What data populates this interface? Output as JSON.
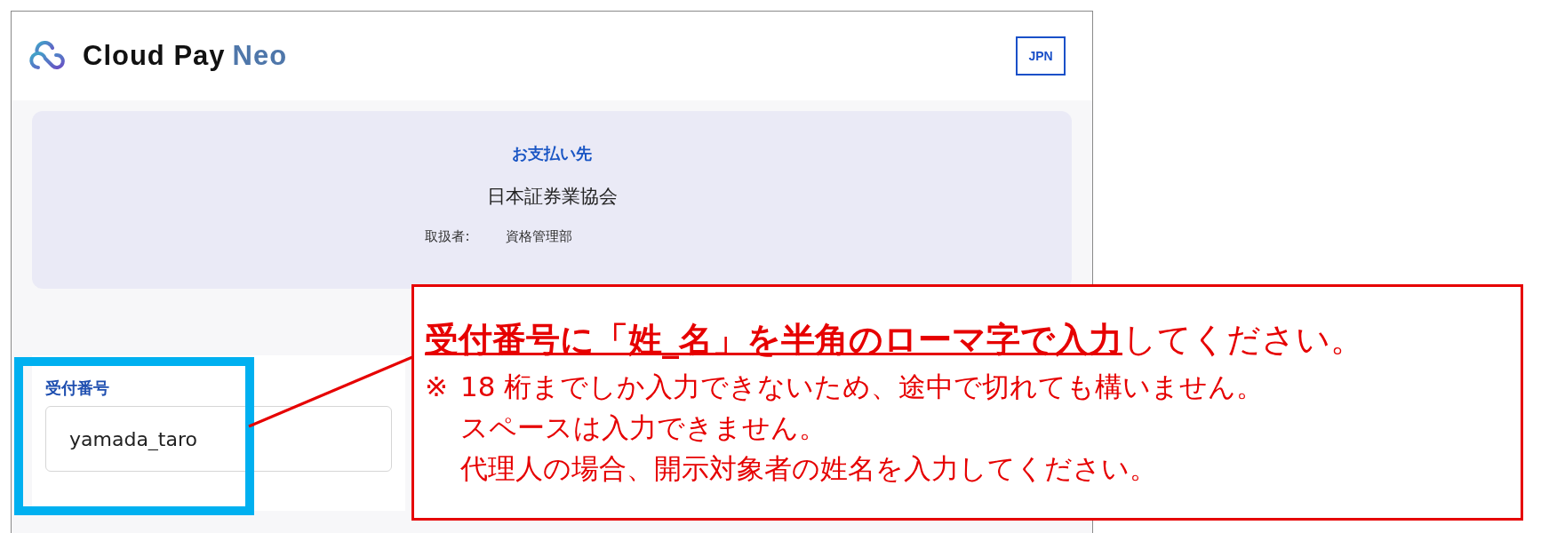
{
  "header": {
    "logo_text": "Cloud Pay",
    "logo_accent": "Neo",
    "language_button": "JPN"
  },
  "payee_card": {
    "heading": "お支払い先",
    "name": "日本証券業協会",
    "handler_label": "取扱者:",
    "handler_value": "資格管理部"
  },
  "field": {
    "label": "受付番号",
    "value": "yamada_taro"
  },
  "annotation": {
    "headline": "**受付番号に「姓_名」を半角のローマ字で入力**してください。",
    "mark": "※",
    "notes": [
      "18 桁までしか入力できないため、途中で切れても構いません。",
      "スペースは入力できません。",
      "代理人の場合、開示対象者の姓名を入力してください。"
    ]
  }
}
